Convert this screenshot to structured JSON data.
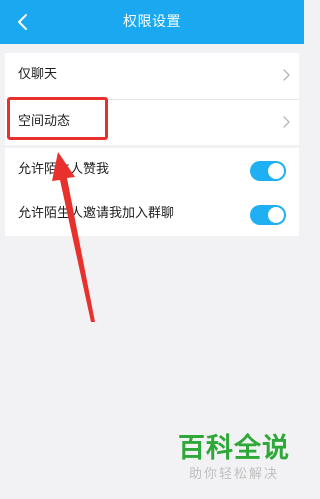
{
  "header": {
    "title": "权限设置",
    "back_icon": "chevron-left-icon",
    "background_color": "#1aa8f0"
  },
  "privacy_group": {
    "items": [
      {
        "label": "仅聊天",
        "icon": "chevron-right-icon"
      },
      {
        "label": "空间动态",
        "icon": "chevron-right-icon"
      }
    ]
  },
  "toggle_group": {
    "items": [
      {
        "label": "允许陌生人赞我",
        "enabled": true
      },
      {
        "label": "允许陌生人邀请我加入群聊",
        "enabled": true
      }
    ],
    "toggle_color": "#1fb0f3"
  },
  "annotation": {
    "highlight_color": "#e8302d",
    "arrow_color": "#e8302d"
  },
  "watermark": {
    "main": "百科全说",
    "sub": "助你轻松解决",
    "main_color": "#2ea838"
  }
}
